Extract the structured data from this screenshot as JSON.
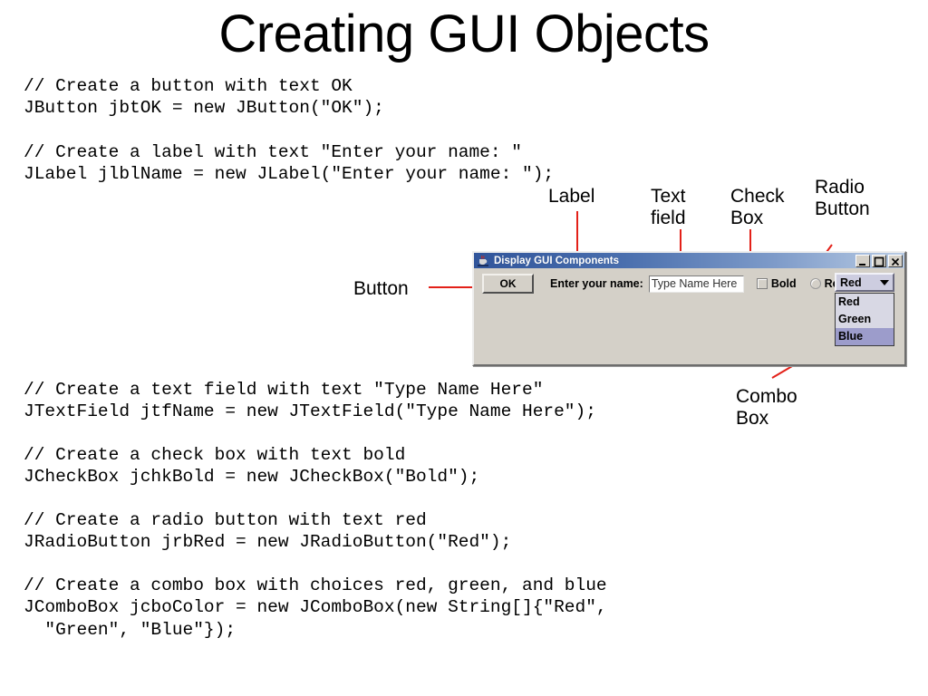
{
  "slide": {
    "title": "Creating GUI Objects"
  },
  "code": {
    "block1": "// Create a button with text OK\nJButton jbtOK = new JButton(\"OK\");",
    "block2": "// Create a label with text \"Enter your name: \"\nJLabel jlblName = new JLabel(\"Enter your name: \");",
    "block3": "// Create a text field with text \"Type Name Here\"\nJTextField jtfName = new JTextField(\"Type Name Here\");",
    "block4": "// Create a check box with text bold\nJCheckBox jchkBold = new JCheckBox(\"Bold\");",
    "block5": "// Create a radio button with text red\nJRadioButton jrbRed = new JRadioButton(\"Red\");",
    "block6": "// Create a combo box with choices red, green, and blue\nJComboBox jcboColor = new JComboBox(new String[]{\"Red\",\n  \"Green\", \"Blue\"});"
  },
  "annotations": {
    "label": "Label",
    "text_field": "Text field",
    "check_box": "Check Box",
    "radio_button": "Radio Button",
    "button": "Button",
    "combo_box": "Combo Box",
    "arrow_color": "#e32119"
  },
  "gui_window": {
    "title": "Display GUI Components",
    "title_icon": "java-cup-icon",
    "title_gradient_start": "#31559b",
    "title_gradient_end": "#b8cbe4",
    "panel_color": "#d4d0c8",
    "window_controls": [
      {
        "name": "minimize-button",
        "glyph": "_"
      },
      {
        "name": "maximize-button",
        "glyph": "□"
      },
      {
        "name": "close-button",
        "glyph": "×"
      }
    ],
    "ok_button": "OK",
    "name_label": "Enter your name:",
    "name_textfield_value": "Type Name Here",
    "bold_checkbox": {
      "label": "Bold",
      "checked": false
    },
    "red_radio": {
      "label": "Red",
      "selected": false
    },
    "combo_box": {
      "selected": "Red",
      "options": [
        "Red",
        "Green",
        "Blue"
      ],
      "highlighted": "Blue",
      "highlight_color": "#9c9ccb",
      "arrow_icon": "chevron-down-icon"
    }
  }
}
